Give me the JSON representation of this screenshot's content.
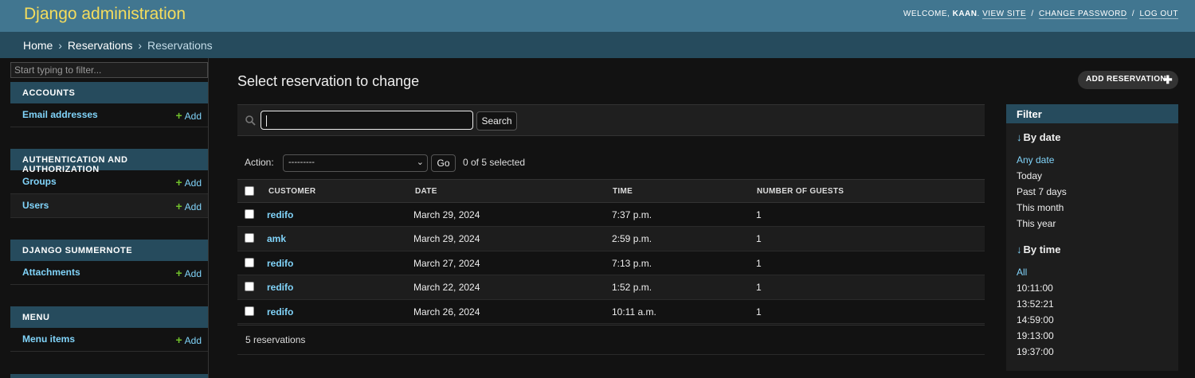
{
  "header": {
    "brand": "Django administration",
    "welcome": "Welcome,",
    "username": "kaan",
    "view_site": "View site",
    "change_password": "Change password",
    "log_out": "Log out",
    "separator": "/"
  },
  "breadcrumbs": {
    "items": [
      "Home",
      "Reservations",
      "Reservations"
    ],
    "separator": "›"
  },
  "sidebar": {
    "filter_placeholder": "Start typing to filter...",
    "add_label": "Add",
    "modules": [
      {
        "caption": "Accounts",
        "models": [
          "Email addresses"
        ]
      },
      {
        "caption": "Authentication and Authorization",
        "models": [
          "Groups",
          "Users"
        ]
      },
      {
        "caption": "Django Summernote",
        "models": [
          "Attachments"
        ]
      },
      {
        "caption": "Menu",
        "models": [
          "Menu items"
        ]
      }
    ]
  },
  "content": {
    "title": "Select reservation to change",
    "add_button": "Add reservation",
    "search_button": "Search",
    "search_value": "",
    "action_label": "Action:",
    "action_selected": "---------",
    "go_button": "Go",
    "action_counter": "0 of 5 selected",
    "columns": [
      "Customer",
      "Date",
      "Time",
      "Number of guests"
    ],
    "rows": [
      {
        "customer": "redifo",
        "date": "March 29, 2024",
        "time": "7:37 p.m.",
        "guests": "1"
      },
      {
        "customer": "amk",
        "date": "March 29, 2024",
        "time": "2:59 p.m.",
        "guests": "1"
      },
      {
        "customer": "redifo",
        "date": "March 27, 2024",
        "time": "7:13 p.m.",
        "guests": "1"
      },
      {
        "customer": "redifo",
        "date": "March 22, 2024",
        "time": "1:52 p.m.",
        "guests": "1"
      },
      {
        "customer": "redifo",
        "date": "March 26, 2024",
        "time": "10:11 a.m.",
        "guests": "1"
      }
    ],
    "paginator": "5 reservations"
  },
  "filter": {
    "heading": "Filter",
    "groups": [
      {
        "title": "By date",
        "selected": "Any date",
        "options": [
          "Any date",
          "Today",
          "Past 7 days",
          "This month",
          "This year"
        ]
      },
      {
        "title": "By time",
        "selected": "All",
        "options": [
          "All",
          "10:11:00",
          "13:52:21",
          "14:59:00",
          "19:13:00",
          "19:37:00"
        ]
      }
    ]
  },
  "colors": {
    "header_bg": "#417690",
    "brand": "#f5dd5d",
    "breadcrumbs_bg": "#264b5d",
    "link": "#81d4fa",
    "add_plus": "#70bf2b",
    "body_bg": "#121212"
  },
  "icons": {
    "search": "search-icon",
    "add": "plus-icon",
    "sort_arrow": "arrow-down-icon",
    "select": "chevron-down-icon"
  }
}
